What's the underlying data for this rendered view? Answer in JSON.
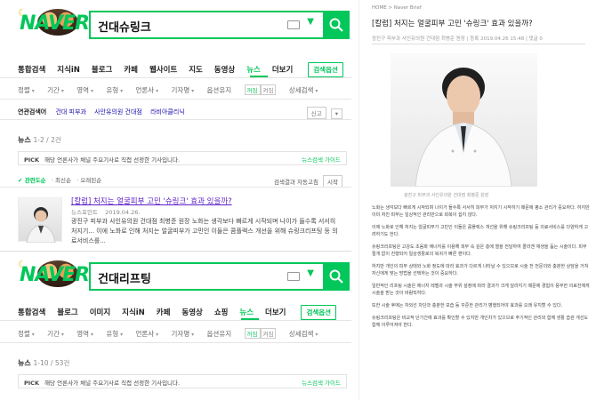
{
  "search1": {
    "logo": "NAVER",
    "query": "건대슈링크",
    "tabs": [
      "통합검색",
      "지식iN",
      "블로그",
      "카페",
      "웹사이트",
      "지도",
      "동영상",
      "뉴스",
      "더보기"
    ],
    "active_tab": "뉴스",
    "option_label": "검색옵션",
    "filters": [
      "정렬",
      "기간",
      "영역",
      "유형",
      "언론사",
      "기자명"
    ],
    "press_label": "옵션유지",
    "press_on": "꺼짐",
    "press_off": "켜짐",
    "detail_label": "상세검색",
    "related_label": "연관검색어",
    "related_terms": [
      "건대 피부과",
      "사안유의원 건대점",
      "라비아클리닉"
    ],
    "report_label": "신고",
    "news_section": "뉴스",
    "news_count": "1-2 / 2건",
    "pick_label": "PICK",
    "pick_text": "해당 언론사가 채널 주요기사로 직접 선정한 기사입니다.",
    "pick_guide": "뉴스검색 가이드",
    "sort_items": [
      "관련도순",
      "최신순",
      "오래된순"
    ],
    "sort_right": "검색결과 자동고침",
    "sort_start": "시작",
    "article": {
      "title": "[칼럼] 처지는 얼굴피부 고민 '슈링크' 효과 있을까?",
      "source": "뉴스포인트",
      "date": "2019.04.26.",
      "desc": "광진구 피부과 사인유의원 건대점 최병준 원장 노화는 생각보다 빠르게 시작되며 나이가 들수록 서서히 처지기... 이에 노화로 인해 처지는 얼굴피부가 고민인 이들은 콤플렉스 개선을 위해 슈링크리프팅 등 의료서비스를..."
    }
  },
  "search2": {
    "query": "건대리프팅",
    "tabs": [
      "통합검색",
      "블로그",
      "이미지",
      "지식iN",
      "카페",
      "동영상",
      "쇼핑",
      "뉴스",
      "더보기"
    ],
    "active_tab": "뉴스",
    "option_label": "검색옵션",
    "filters": [
      "정렬",
      "기간",
      "영역",
      "유형",
      "언론사",
      "기자명"
    ],
    "press_label": "옵션유지",
    "press_on": "꺼짐",
    "press_off": "켜짐",
    "detail_label": "상세검색",
    "news_section": "뉴스",
    "news_count": "1-10 / 53건",
    "pick_label": "PICK",
    "pick_text": "해당 언론사가 채널 주요기사로 직접 선정한 기사입니다.",
    "pick_guide": "뉴스검색 가이드"
  },
  "article_page": {
    "breadcrumb": "HOME > Naver Brief",
    "title": "[칼럼] 처지는 얼굴피부 고민 '슈링크' 효과 있을까?",
    "meta": "광진구 피부과 사인유의원 건대점 최병준 원장 | 등록 2019.04.26 15:48 | 댓글 0",
    "caption": "광진구 피부과 사인유의원 건대점 최병준 원장",
    "body": [
      "노화는 생각보다 빠르게 시작되며 나이가 들수록 서서히 피부가 처지기 시작하기 때문에 평소 관리가 중요하다. 하지만 이미 처진 피부는 일상적인 관리만으로 회복이 쉽지 않다.",
      "이에 노화로 인해 처지는 얼굴피부가 고민인 이들은 콤플렉스 개선을 위해 슈링크리프팅 등 의료서비스를 다양하게 고려하기도 한다.",
      "슈링크리프팅은 고강도 초음파 에너지를 이용해 피부 속 깊은 층에 열을 전달하여 콜라겐 재생을 돕는 시술이다. 피부 절개 없이 진행되어 일상생활로의 복귀가 빠른 편이다.",
      "하지만 개인의 피부 상태와 노화 정도에 따라 효과가 다르게 나타날 수 있으므로 시술 전 전문의와 충분한 상담을 거쳐 자신에게 맞는 방법을 선택하는 것이 중요하다.",
      "일반적인 리프팅 시술은 에너지 레벨과 시술 부위 설정에 따라 결과가 크게 달라지기 때문에 경험이 풍부한 의료진에게 시술을 받는 것이 바람직하다.",
      "또한 시술 후에는 자외선 차단과 충분한 보습 등 꾸준한 관리가 병행되어야 효과를 오래 유지할 수 있다.",
      "슈링크리프팅은 비교적 단기간에 효과를 확인할 수 있지만 개인차가 있으므로 주기적인 관리와 함께 생활 습관 개선도 함께 이루어져야 한다."
    ]
  },
  "colors": {
    "accent": "#03c75a",
    "visited": "#5d22c7"
  },
  "icons": [
    "search-icon",
    "keyboard-icon",
    "chevron-down-icon",
    "gear-icon"
  ]
}
